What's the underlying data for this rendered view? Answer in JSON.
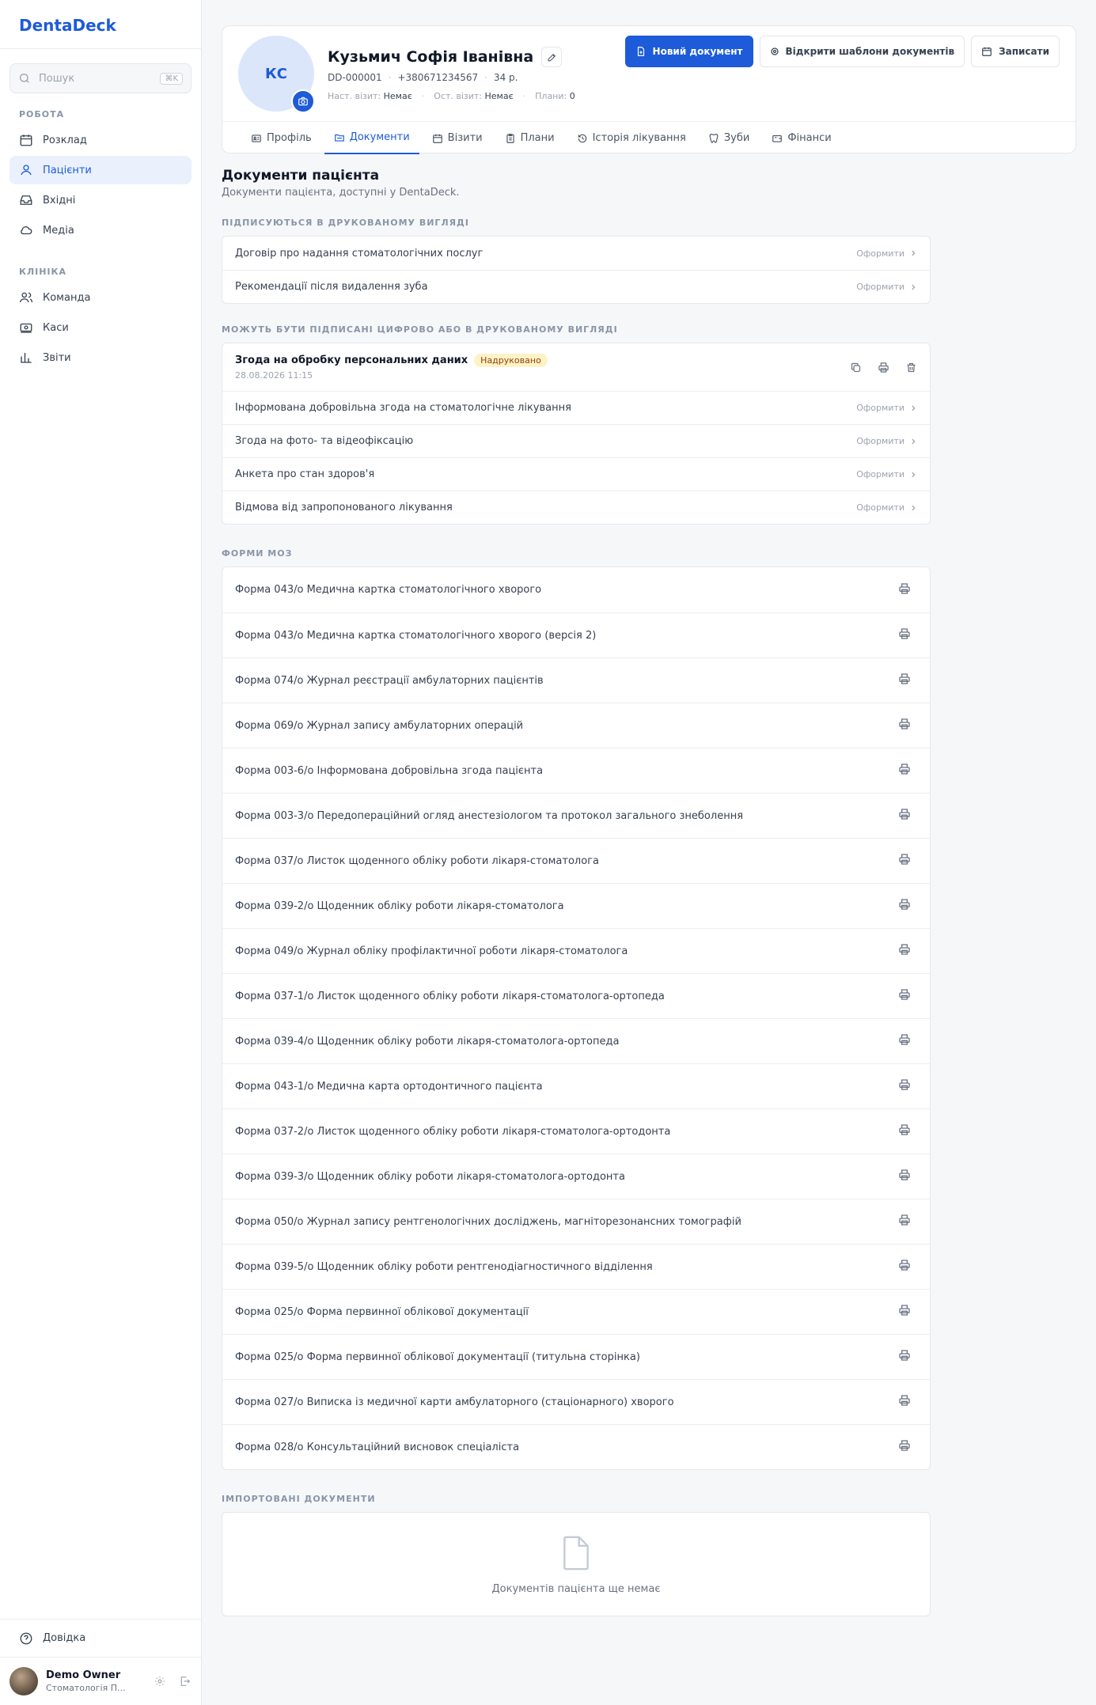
{
  "app": {
    "logo": "DentaDeck"
  },
  "sidebar": {
    "search_placeholder": "Пошук",
    "search_shortcut": "⌘K",
    "sections": {
      "work": "РОБОТА",
      "clinic": "КЛІНІКА"
    },
    "items": {
      "schedule": "Розклад",
      "patients": "Пацієнти",
      "inbox": "Вхідні",
      "media": "Медіа",
      "team": "Команда",
      "cashboxes": "Каси",
      "reports": "Звіти"
    },
    "help": "Довідка",
    "user": {
      "name": "Demo Owner",
      "subtitle": "Стоматологія П..."
    }
  },
  "patient": {
    "initials": "КС",
    "name": "Кузьмич Софія Іванівна",
    "id": "DD-000001",
    "phone": "+380671234567",
    "age": "34 р.",
    "next_visit_label": "Наст. візит:",
    "next_visit": "Немає",
    "last_visit_label": "Ост. візит:",
    "last_visit": "Немає",
    "plans_label": "Плани:",
    "plans": "0"
  },
  "actions": {
    "new_document": "Новий документ",
    "open_templates": "Відкрити шаблони документів",
    "book": "Записати"
  },
  "tabs": {
    "profile": "Профіль",
    "documents": "Документи",
    "visits": "Візити",
    "plans": "Плани",
    "history": "Історія лікування",
    "teeth": "Зуби",
    "finance": "Фінанси"
  },
  "page": {
    "title": "Документи пацієнта",
    "subtitle": "Документи пацієнта, доступні у DentaDeck."
  },
  "print_signed": {
    "label": "ПІДПИСУЮТЬСЯ В ДРУКОВАНОМУ ВИГЛЯДІ",
    "action": "Оформити",
    "items": [
      "Договір про надання стоматологічних послуг",
      "Рекомендації після видалення зуба"
    ]
  },
  "digital_or_print": {
    "label": "МОЖУТЬ БУТИ ПІДПИСАНІ ЦИФРОВО АБО В ДРУКОВАНОМУ ВИГЛЯДІ",
    "action": "Оформити",
    "signed": {
      "title": "Згода на обробку персональних даних",
      "badge": "Надруковано",
      "date": "28.08.2026 11:15"
    },
    "items": [
      "Інформована добровільна згода на стоматологічне лікування",
      "Згода на фото- та відеофіксацію",
      "Анкета про стан здоров'я",
      "Відмова від запропонованого лікування"
    ]
  },
  "moz_forms": {
    "label": "ФОРМИ МОЗ",
    "items": [
      "Форма 043/о Медична картка стоматологічного хворого",
      "Форма 043/о Медична картка стоматологічного хворого (версія 2)",
      "Форма 074/о Журнал реєстрації амбулаторних пацієнтів",
      "Форма 069/о Журнал запису амбулаторних операцій",
      "Форма 003-6/о Інформована добровільна згода пацієнта",
      "Форма 003-3/о Передопераційний огляд анестезіологом та протокол загального знеболення",
      "Форма 037/о Листок щоденного обліку роботи лікаря-стоматолога",
      "Форма 039-2/о Щоденник обліку роботи лікаря-стоматолога",
      "Форма 049/о Журнал обліку профілактичної роботи лікаря-стоматолога",
      "Форма 037-1/о Листок щоденного обліку роботи лікаря-стоматолога-ортопеда",
      "Форма 039-4/о Щоденник обліку роботи лікаря-стоматолога-ортопеда",
      "Форма 043-1/о Медична карта ортодонтичного пацієнта",
      "Форма 037-2/о Листок щоденного обліку роботи лікаря-стоматолога-ортодонта",
      "Форма 039-3/о Щоденник обліку роботи лікаря-стоматолога-ортодонта",
      "Форма 050/о Журнал запису рентгенологічних досліджень, магніторезонансних томографій",
      "Форма 039-5/о Щоденник обліку роботи рентгенодіагностичного відділення",
      "Форма 025/о Форма первинної облікової документації",
      "Форма 025/о Форма первинної облікової документації (титульна сторінка)",
      "Форма 027/о Виписка із медичної карти амбулаторного (стаціонарного) хворого",
      "Форма 028/о Консультаційний висновок спеціаліста"
    ]
  },
  "imported": {
    "label": "ІМПОРТОВАНІ ДОКУМЕНТИ",
    "empty": "Документів пацієнта ще немає"
  },
  "colors": {
    "accent": "#1d5bd8",
    "badge_bg": "#fef3c7"
  }
}
